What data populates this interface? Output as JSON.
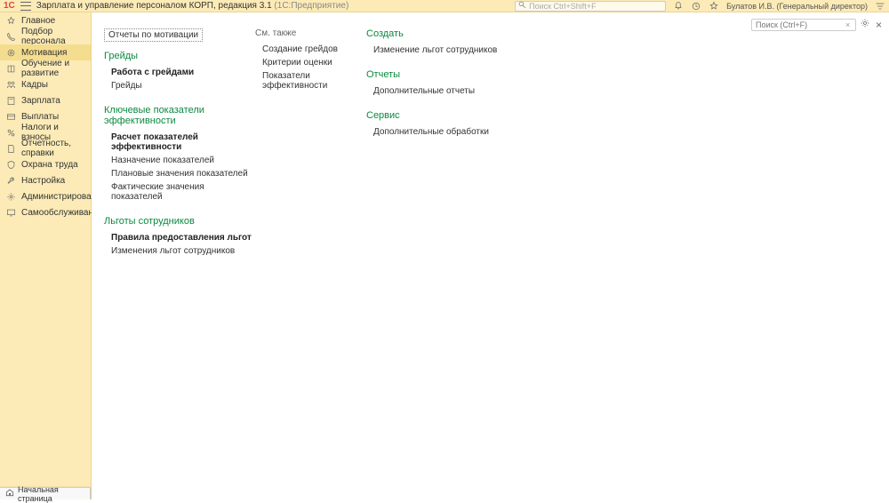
{
  "titlebar": {
    "logo": "1С",
    "app_title": "Зарплата и управление персоналом КОРП, редакция 3.1",
    "app_subtitle": "(1С:Предприятие)",
    "search_placeholder": "Поиск Ctrl+Shift+F",
    "user": "Булатов И.В. (Генеральный директор)"
  },
  "sidebar": {
    "items": [
      {
        "label": "Главное"
      },
      {
        "label": "Подбор персонала"
      },
      {
        "label": "Мотивация"
      },
      {
        "label": "Обучение и развитие"
      },
      {
        "label": "Кадры"
      },
      {
        "label": "Зарплата"
      },
      {
        "label": "Выплаты"
      },
      {
        "label": "Налоги и взносы"
      },
      {
        "label": "Отчетность, справки"
      },
      {
        "label": "Охрана труда"
      },
      {
        "label": "Настройка"
      },
      {
        "label": "Администрирование"
      },
      {
        "label": "Самообслуживание"
      }
    ]
  },
  "content": {
    "search_placeholder": "Поиск (Ctrl+F)",
    "top_link": "Отчеты по мотивации",
    "col1": {
      "s1_title": "Грейды",
      "s1_links": [
        "Работа с грейдами",
        "Грейды"
      ],
      "s2_title": "Ключевые показатели эффективности",
      "s2_links": [
        "Расчет показателей эффективности",
        "Назначение показателей",
        "Плановые значения показателей",
        "Фактические значения показателей"
      ],
      "s3_title": "Льготы сотрудников",
      "s3_links": [
        "Правила предоставления льгот",
        "Изменения льгот сотрудников"
      ]
    },
    "col2": {
      "s1_title": "См. также",
      "s1_links": [
        "Создание грейдов",
        "Критерии оценки",
        "Показатели эффективности"
      ]
    },
    "col3": {
      "s1_title": "Создать",
      "s1_links": [
        "Изменение льгот сотрудников"
      ],
      "s2_title": "Отчеты",
      "s2_links": [
        "Дополнительные отчеты"
      ],
      "s3_title": "Сервис",
      "s3_links": [
        "Дополнительные обработки"
      ]
    }
  },
  "footer": {
    "home_label": "Начальная страница"
  }
}
